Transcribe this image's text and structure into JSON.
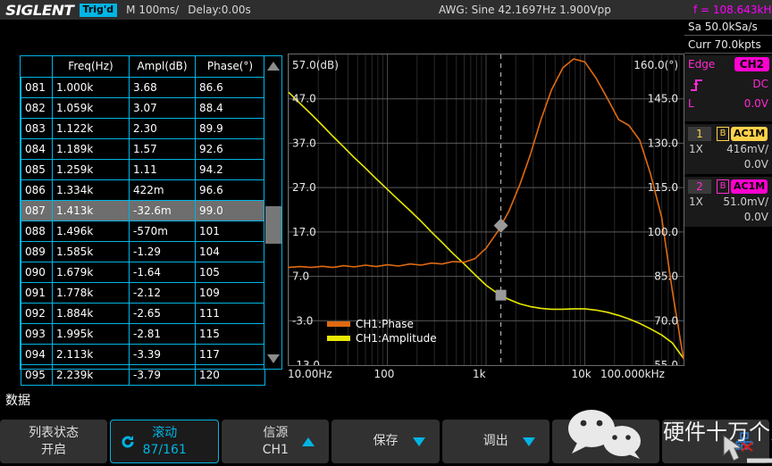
{
  "header": {
    "logo": "SIGLENT",
    "trig_status": "Trig'd",
    "timebase": "M 100ms/",
    "delay": "Delay:0.00s",
    "awg": "AWG: Sine  42.1697Hz  1.900Vpp",
    "freq": "f = 108.643kHz",
    "trig_color": "#00b4e4",
    "freq_color": "#ff00ff"
  },
  "sidebar": {
    "sample_rate": "Sa 50.0kSa/s",
    "memory": "Curr 70.0kpts",
    "trigger": {
      "type": "Edge",
      "source": "CH2",
      "slope_icon": "rising-edge-icon",
      "coupling": "DC",
      "level_label": "L",
      "level_value": "0.0V",
      "color": "#ff2ad4"
    },
    "channels": [
      {
        "num": "1",
        "bw": "B",
        "coupling": "AC1M",
        "probe": "1X",
        "scale": "416mV/",
        "offset": "0.0V",
        "color": "#ffd24a"
      },
      {
        "num": "2",
        "bw": "B",
        "coupling": "AC1M",
        "probe": "1X",
        "scale": "51.0mV/",
        "offset": "0.0V",
        "color": "#ff00d0"
      }
    ]
  },
  "table": {
    "columns": [
      "",
      "Freq(Hz)",
      "Ampl(dB)",
      "Phase(°)"
    ],
    "selected_index": 6,
    "rows": [
      [
        "081",
        "1.000k",
        "3.68",
        "86.6"
      ],
      [
        "082",
        "1.059k",
        "3.07",
        "88.4"
      ],
      [
        "083",
        "1.122k",
        "2.30",
        "89.9"
      ],
      [
        "084",
        "1.189k",
        "1.57",
        "92.6"
      ],
      [
        "085",
        "1.259k",
        "1.11",
        "94.2"
      ],
      [
        "086",
        "1.334k",
        "422m",
        "96.6"
      ],
      [
        "087",
        "1.413k",
        "-32.6m",
        "99.0"
      ],
      [
        "088",
        "1.496k",
        "-570m",
        "101"
      ],
      [
        "089",
        "1.585k",
        "-1.29",
        "104"
      ],
      [
        "090",
        "1.679k",
        "-1.64",
        "105"
      ],
      [
        "091",
        "1.778k",
        "-2.12",
        "109"
      ],
      [
        "092",
        "1.884k",
        "-2.65",
        "111"
      ],
      [
        "093",
        "1.995k",
        "-2.81",
        "115"
      ],
      [
        "094",
        "2.113k",
        "-3.39",
        "117"
      ],
      [
        "095",
        "2.239k",
        "-3.79",
        "120"
      ]
    ]
  },
  "chart_data": {
    "type": "line",
    "title": "",
    "xlabel": "",
    "ylabel": "",
    "x_log": true,
    "xlim": [
      10,
      100000
    ],
    "x_ticks": [
      "10.00Hz",
      "100",
      "1k",
      "10k",
      "100.000kHz"
    ],
    "x_tick_values": [
      10,
      100,
      1000,
      10000,
      100000
    ],
    "left_axis": {
      "label": "57.0(dB)",
      "unit": "dB",
      "ticks": [
        "57.0(dB)",
        "47.0",
        "37.0",
        "27.0",
        "17.0",
        "7.0",
        "-3.0",
        "-13.0"
      ],
      "tick_values": [
        57.0,
        47.0,
        37.0,
        27.0,
        17.0,
        7.0,
        -3.0,
        -13.0
      ],
      "ylim": [
        -13.0,
        57.0
      ]
    },
    "right_axis": {
      "label": "160.0(°)",
      "unit": "deg",
      "ticks": [
        "160.0(°)",
        "145.0",
        "130.0",
        "115.0",
        "100.0",
        "85.0",
        "70.0",
        "55.0"
      ],
      "tick_values": [
        160.0,
        145.0,
        130.0,
        115.0,
        100.0,
        85.0,
        70.0,
        55.0
      ],
      "ylim": [
        55.0,
        160.0
      ]
    },
    "legend": [
      {
        "name": "CH1:Phase",
        "color": "#e06a10"
      },
      {
        "name": "CH1:Amplitude",
        "color": "#e8e800"
      }
    ],
    "series": [
      {
        "name": "CH1:Amplitude",
        "axis": "left",
        "color": "#e8e800",
        "x": [
          10,
          13,
          17,
          22,
          28,
          36,
          46,
          60,
          77,
          100,
          130,
          170,
          220,
          280,
          360,
          460,
          600,
          770,
          1000,
          1300,
          1700,
          2200,
          2800,
          3600,
          4600,
          6000,
          7700,
          10000,
          13000,
          17000,
          22000,
          28000,
          36000,
          46000,
          60000,
          77000,
          100000
        ],
        "y": [
          48.5,
          46.0,
          43.5,
          41.0,
          38.6,
          36.2,
          33.8,
          31.4,
          29.0,
          26.6,
          24.2,
          21.8,
          19.4,
          17.0,
          14.6,
          12.2,
          9.8,
          7.4,
          5.0,
          3.2,
          1.8,
          0.8,
          0.2,
          -0.2,
          -0.4,
          -0.4,
          -0.3,
          -0.3,
          -0.6,
          -1.1,
          -1.8,
          -2.6,
          -3.6,
          -4.8,
          -6.2,
          -8.0,
          -11.5
        ]
      },
      {
        "name": "CH1:Phase",
        "axis": "right",
        "color": "#e06a10",
        "x": [
          10,
          13,
          17,
          22,
          28,
          36,
          46,
          60,
          77,
          100,
          130,
          170,
          220,
          280,
          360,
          460,
          600,
          770,
          1000,
          1300,
          1700,
          2200,
          2800,
          3600,
          4600,
          6000,
          7700,
          10000,
          13000,
          17000,
          22000,
          28000,
          36000,
          46000,
          60000,
          77000,
          100000
        ],
        "y": [
          88.0,
          88.3,
          88.0,
          88.4,
          88.0,
          88.6,
          88.2,
          88.8,
          88.3,
          88.9,
          88.5,
          89.2,
          88.8,
          89.5,
          89.2,
          90.0,
          89.8,
          91.0,
          94.5,
          100.0,
          107.0,
          116.0,
          126.0,
          138.0,
          148.0,
          155.5,
          158.5,
          157.5,
          152.0,
          145.0,
          138.0,
          136.0,
          131.0,
          120.0,
          105.0,
          80.0,
          57.0
        ]
      }
    ],
    "cursor": {
      "x_value": 1413,
      "markers": [
        {
          "series": "CH1:Phase",
          "shape": "diamond",
          "color": "#9a9a9a"
        },
        {
          "series": "CH1:Amplitude",
          "shape": "square",
          "color": "#9a9a9a"
        }
      ]
    }
  },
  "bottom": {
    "section_label": "数据",
    "buttons": [
      {
        "line1": "列表状态",
        "line2": "开启",
        "icon": "",
        "active": false
      },
      {
        "line1": "滚动",
        "line2": "87/161",
        "icon": "refresh-icon",
        "active": true
      },
      {
        "line1": "信源",
        "line2": "CH1",
        "icon": "arrow-up-icon",
        "active": false
      },
      {
        "line1": "保存",
        "line2": "",
        "icon": "arrow-down-icon",
        "active": false
      },
      {
        "line1": "调出",
        "line2": "",
        "icon": "arrow-down-icon",
        "active": false
      },
      {
        "line1": "",
        "line2": "",
        "icon": "",
        "active": false
      },
      {
        "line1": "",
        "line2": "",
        "icon": "network-disconnected-icon",
        "active": false
      }
    ]
  },
  "watermark": {
    "text": "硬件十万个为什么",
    "icon": "wechat-icon"
  }
}
